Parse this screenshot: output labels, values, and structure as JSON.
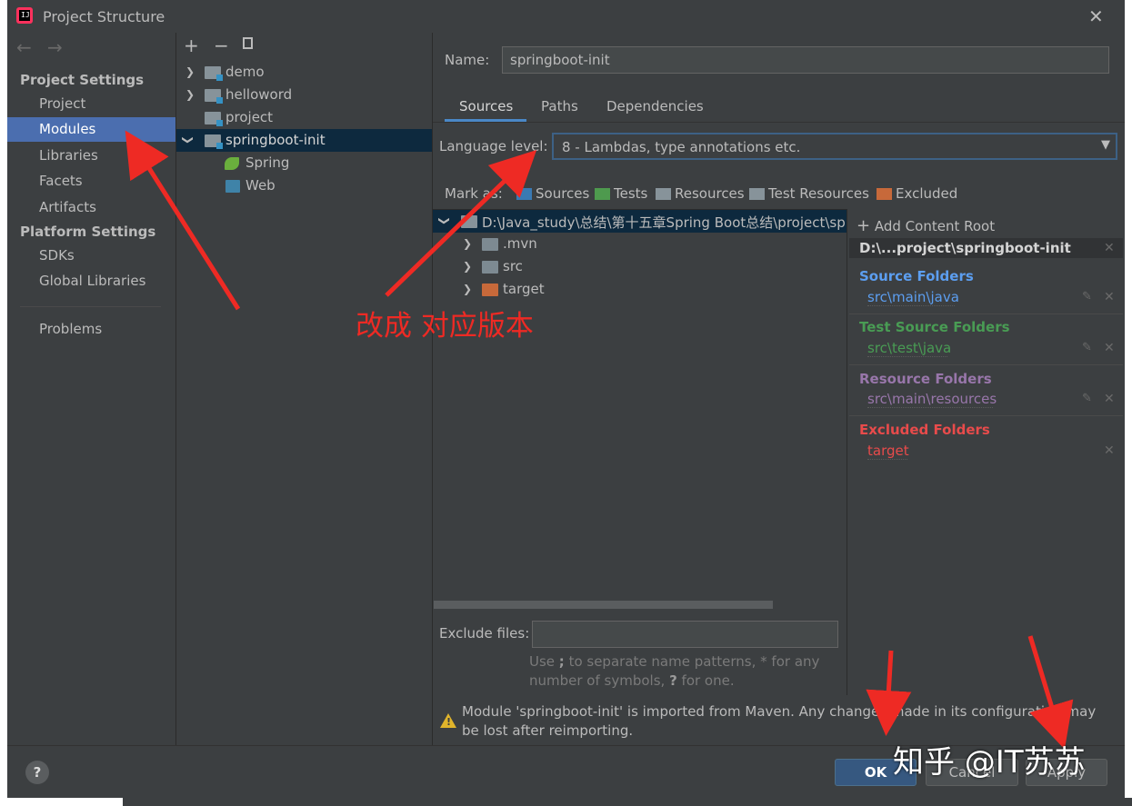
{
  "window": {
    "title": "Project Structure",
    "app_icon_text": "IJ",
    "close_icon": "close-icon"
  },
  "nav": {
    "back_icon": "arrow-left-icon",
    "forward_icon": "arrow-right-icon",
    "project_settings_header": "Project Settings",
    "project_settings_items": [
      "Project",
      "Modules",
      "Libraries",
      "Facets",
      "Artifacts"
    ],
    "selected": "Modules",
    "platform_settings_header": "Platform Settings",
    "platform_settings_items": [
      "SDKs",
      "Global Libraries"
    ],
    "problems": "Problems"
  },
  "module_tree": {
    "toolbar": [
      "add-icon",
      "remove-icon",
      "copy-icon"
    ],
    "items": [
      {
        "label": "demo",
        "expandable": true
      },
      {
        "label": "helloword",
        "expandable": true
      },
      {
        "label": "project",
        "expandable": false
      },
      {
        "label": "springboot-init",
        "expandable": true,
        "expanded": true,
        "selected": true
      },
      {
        "label": "Spring",
        "facet": true
      },
      {
        "label": "Web",
        "facet": true
      }
    ]
  },
  "module": {
    "name_label": "Name:",
    "name_value": "springboot-init",
    "tabs": [
      "Sources",
      "Paths",
      "Dependencies"
    ],
    "active_tab": "Sources",
    "language_level_label": "Language level:",
    "language_level_value": "8 - Lambdas, type annotations etc.",
    "mark_as_label": "Mark as:",
    "mark_as": [
      "Sources",
      "Tests",
      "Resources",
      "Test Resources",
      "Excluded"
    ],
    "mark_colors": {
      "Sources": "#3a7ab3",
      "Tests": "#4e9a4e",
      "Resources": "#87939a",
      "Test Resources": "#87939a",
      "Excluded": "#c7693a"
    },
    "source_tree": [
      {
        "label": "D:\\Java_study\\总结\\第十五章Spring Boot总结\\project\\spri",
        "expanded": true
      },
      {
        "label": ".mvn"
      },
      {
        "label": "src"
      },
      {
        "label": "target",
        "excluded": true
      }
    ],
    "exclude_files_label": "Exclude files:",
    "exclude_files_value": "",
    "exclude_hint_1": "Use ",
    "exclude_hint_semicolon": ";",
    "exclude_hint_2": " to separate name patterns, * for any number of symbols, ",
    "exclude_hint_q": "?",
    "exclude_hint_3": " for one."
  },
  "content_root": {
    "add_label": "Add Content Root",
    "path": "D:\\...project\\springboot-init",
    "groups": [
      {
        "title": "Source Folders",
        "path": "src\\main\\java",
        "color": "#5c9ef0",
        "editable": true
      },
      {
        "title": "Test Source Folders",
        "path": "src\\test\\java",
        "color": "#499c54",
        "editable": true
      },
      {
        "title": "Resource Folders",
        "path": "src\\main\\resources",
        "color": "#9876aa",
        "editable": true
      },
      {
        "title": "Excluded Folders",
        "path": "target",
        "color": "#e84b4b",
        "editable": false
      }
    ]
  },
  "warning": {
    "text": "Module 'springboot-init' is imported from Maven. Any changes made in its configuration may be lost after reimporting."
  },
  "buttons": {
    "help": "?",
    "ok": "OK",
    "cancel": "Cancel",
    "apply": "Apply"
  },
  "annotation": {
    "text": "改成 对应版本",
    "color": "#ee2a24"
  },
  "watermark": "知乎 @IT苏苏"
}
